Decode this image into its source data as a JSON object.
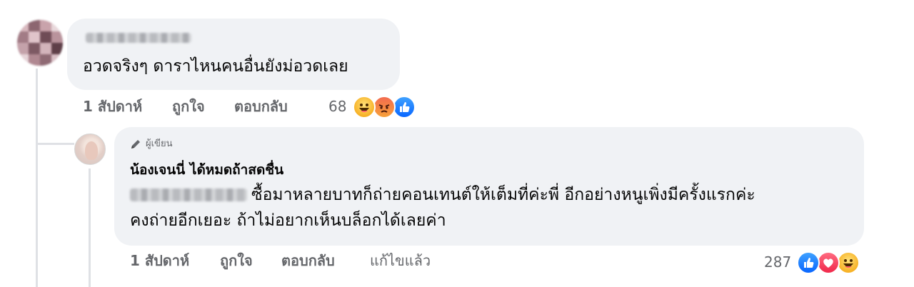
{
  "comment1": {
    "author_name": "",
    "body": "อวดจริงๆ ดาราไหนคนอื่นยังม่อวดเลย",
    "time": "1 สัปดาห์",
    "like_label": "ถูกใจ",
    "reply_label": "ตอบกลับ",
    "reaction_count": "68",
    "reactions": [
      "haha-icon",
      "angry-icon",
      "like-icon"
    ]
  },
  "comment2": {
    "author_badge": "ผู้เขียน",
    "author_name": "น้องเจนนี่ ได้หมดถ้าสดชื่น",
    "body_line1": "ซื้อมาหลายบาทก็ถ่ายคอนเทนต์ให้เต็มที่ค่ะพี่ อีกอย่างหนูเพิ่งมีครั้งแรกค่ะ",
    "body_line2": "คงถ่ายอีกเยอะ ถ้าไม่อยากเห็นบล็อกได้เลยค่า",
    "time": "1 สัปดาห์",
    "like_label": "ถูกใจ",
    "reply_label": "ตอบกลับ",
    "edited_label": "แก้ไขแล้ว",
    "reaction_count": "287",
    "reactions": [
      "like-icon",
      "love-icon",
      "haha-icon"
    ]
  },
  "colors": {
    "bubble": "#f0f2f5",
    "meta_text": "#65676b",
    "like_blue": "#0866ff",
    "love_red": "#f0284a",
    "haha_yellow": "#f7b125"
  }
}
